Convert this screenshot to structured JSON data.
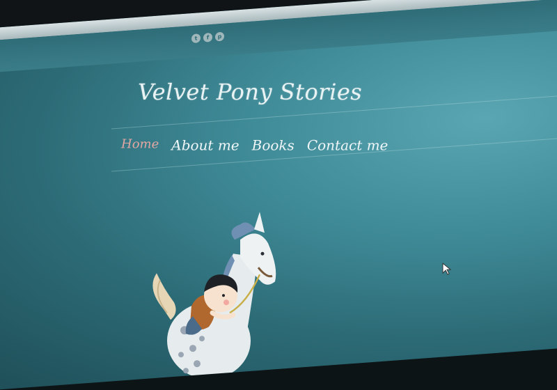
{
  "site": {
    "title": "Velvet Pony Stories"
  },
  "social": {
    "icons": [
      "twitter-icon",
      "facebook-icon",
      "pinterest-icon"
    ],
    "glyphs": [
      "t",
      "f",
      "p"
    ]
  },
  "nav": {
    "items": [
      {
        "label": "Home",
        "active": true
      },
      {
        "label": "About me",
        "active": false
      },
      {
        "label": "Books",
        "active": false
      },
      {
        "label": "Contact me",
        "active": false
      }
    ]
  },
  "colors": {
    "background": "#3f8a97",
    "nav_active": "#e3a7a3",
    "nav_text": "#f0f7f8",
    "title_text": "#eaf3f4"
  }
}
